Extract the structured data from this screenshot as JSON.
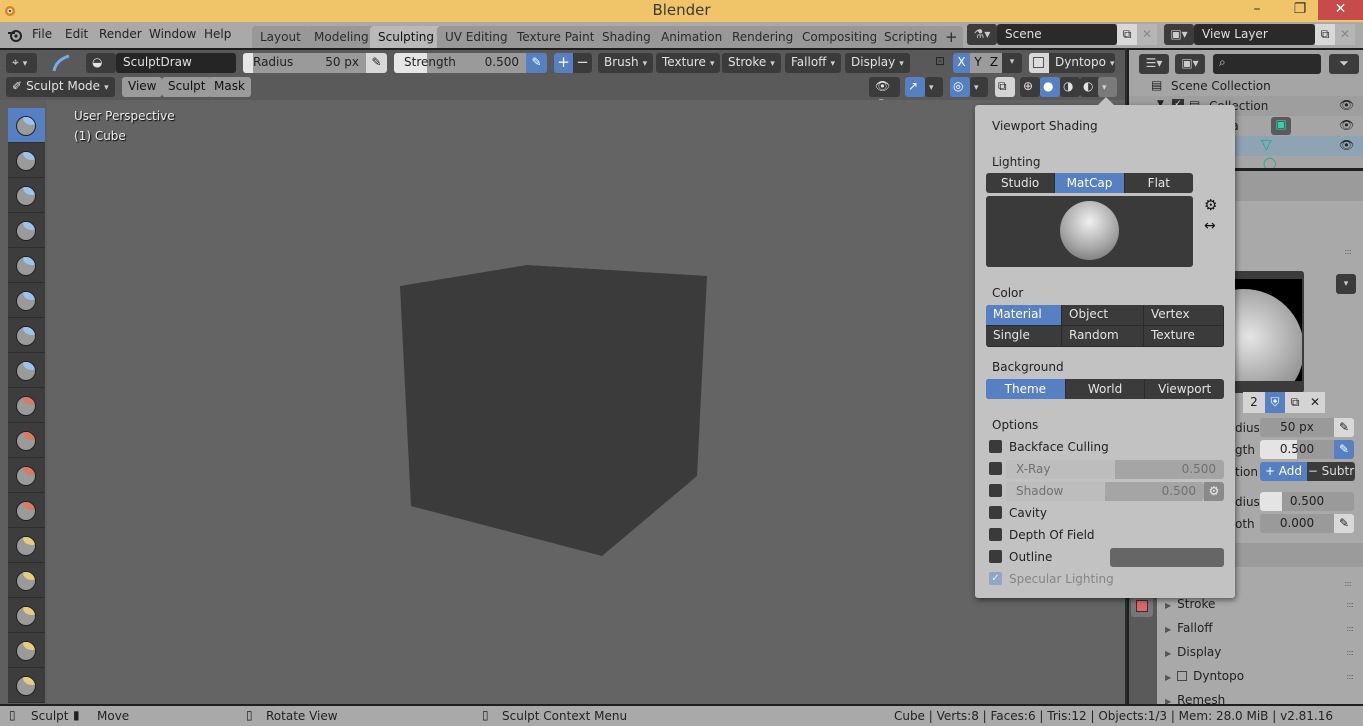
{
  "window": {
    "title": "Blender",
    "minimize": "–",
    "maximize": "❐",
    "close": "✕"
  },
  "menu": [
    "File",
    "Edit",
    "Render",
    "Window",
    "Help"
  ],
  "workspace_tabs": [
    {
      "label": "Layout",
      "active": false
    },
    {
      "label": "Modeling",
      "active": false
    },
    {
      "label": "Sculpting",
      "active": true
    },
    {
      "label": "UV Editing",
      "active": false
    },
    {
      "label": "Texture Paint",
      "active": false
    },
    {
      "label": "Shading",
      "active": false
    },
    {
      "label": "Animation",
      "active": false
    },
    {
      "label": "Rendering",
      "active": false
    },
    {
      "label": "Compositing",
      "active": false
    },
    {
      "label": "Scripting",
      "active": false
    }
  ],
  "add_workspace": "+",
  "scene": {
    "name": "Scene",
    "view_layer": "View Layer"
  },
  "tool_header": {
    "brush_name": "SculptDraw",
    "radius_label": "Radius",
    "radius_value": "50 px",
    "strength_label": "Strength",
    "strength_value": "0.500",
    "strength_fraction": 0.5,
    "add": "+",
    "subtract": "−",
    "dropdowns": [
      "Brush",
      "Texture",
      "Stroke",
      "Falloff",
      "Display"
    ],
    "axes": [
      "X",
      "Y",
      "Z"
    ],
    "dyntopo": "Dyntopo"
  },
  "mode_header": {
    "mode": "Sculpt Mode",
    "menus": [
      "View",
      "Sculpt",
      "Mask"
    ]
  },
  "viewport": {
    "perspective": "User Perspective",
    "object": "(1) Cube"
  },
  "tools": [
    {
      "name": "draw",
      "cap": "#9cc3ea",
      "active": true
    },
    {
      "name": "draw-sharp",
      "cap": "#9cc3ea"
    },
    {
      "name": "clay",
      "cap": "#9cc3ea"
    },
    {
      "name": "clay-strips",
      "cap": "#9cc3ea"
    },
    {
      "name": "layer",
      "cap": "#9cc3ea"
    },
    {
      "name": "inflate",
      "cap": "#9cc3ea"
    },
    {
      "name": "blob",
      "cap": "#9cc3ea"
    },
    {
      "name": "crease",
      "cap": "#9cc3ea"
    },
    {
      "name": "smooth",
      "cap": "#d97a66"
    },
    {
      "name": "flatten",
      "cap": "#d97a66"
    },
    {
      "name": "fill",
      "cap": "#d97a66"
    },
    {
      "name": "scrape",
      "cap": "#d97a66"
    },
    {
      "name": "pinch",
      "cap": "#e4cd80"
    },
    {
      "name": "grab",
      "cap": "#e4cd80"
    },
    {
      "name": "snake-hook",
      "cap": "#e4cd80"
    },
    {
      "name": "thumb",
      "cap": "#e4cd80"
    },
    {
      "name": "nudge",
      "cap": "#e4cd80"
    }
  ],
  "outliner": {
    "search_placeholder": "",
    "items": [
      {
        "label": "Scene Collection"
      },
      {
        "label": "Collection"
      },
      {
        "label": "era"
      },
      {
        "label": ""
      }
    ]
  },
  "properties": {
    "texture_slot": "2",
    "rows": [
      {
        "label": "dius",
        "value": "50 px"
      },
      {
        "label": "gth",
        "value": "0.500"
      },
      {
        "label": "tion",
        "add": "+ Add",
        "subtract": "− Subtr"
      },
      {
        "label": "dius",
        "value": "0.500"
      },
      {
        "label": "oth",
        "value": "0.000"
      }
    ],
    "panels": [
      "Stroke",
      "Falloff",
      "Display",
      "Dyntopo",
      "Remesh"
    ]
  },
  "popover": {
    "title": "Viewport Shading",
    "lighting_label": "Lighting",
    "lighting": [
      {
        "label": "Studio"
      },
      {
        "label": "MatCap",
        "on": true
      },
      {
        "label": "Flat"
      }
    ],
    "color_label": "Color",
    "color": [
      {
        "label": "Material",
        "on": true
      },
      {
        "label": "Object"
      },
      {
        "label": "Vertex"
      },
      {
        "label": "Single"
      },
      {
        "label": "Random"
      },
      {
        "label": "Texture"
      }
    ],
    "background_label": "Background",
    "background": [
      {
        "label": "Theme",
        "on": true
      },
      {
        "label": "World"
      },
      {
        "label": "Viewport"
      }
    ],
    "options_label": "Options",
    "options": {
      "backface_culling": {
        "label": "Backface Culling",
        "checked": false
      },
      "xray": {
        "label": "X-Ray",
        "checked": false,
        "value": "0.500"
      },
      "shadow": {
        "label": "Shadow",
        "checked": false,
        "value": "0.500"
      },
      "cavity": {
        "label": "Cavity",
        "checked": false
      },
      "dof": {
        "label": "Depth Of Field",
        "checked": false
      },
      "outline": {
        "label": "Outline",
        "checked": false
      },
      "specular": {
        "label": "Specular Lighting",
        "checked": true
      }
    }
  },
  "statusbar": {
    "left": [
      {
        "icon": "mouse-left-icon",
        "label": "Sculpt"
      },
      {
        "icon": "mouse-drag-icon",
        "label": "Move"
      },
      {
        "icon": "mouse-middle-icon",
        "label": "Rotate View"
      },
      {
        "icon": "mouse-right-icon",
        "label": "Sculpt Context Menu"
      }
    ],
    "stats": "Cube | Verts:8 | Faces:6 | Tris:12 | Objects:1/3 | Mem: 28.0 MiB | v2.81.16"
  }
}
